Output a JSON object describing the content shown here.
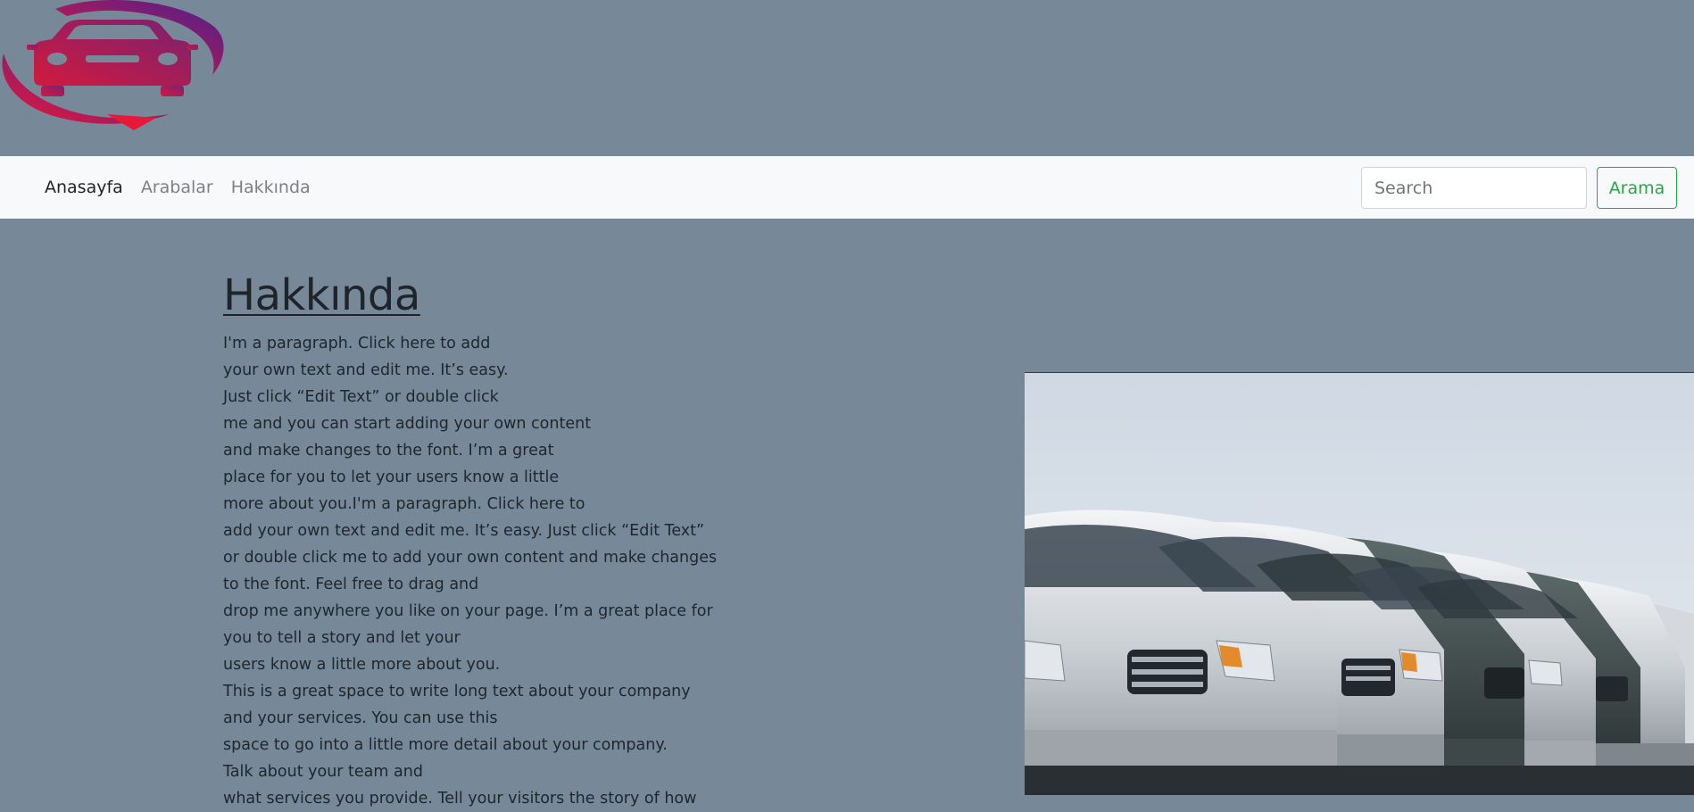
{
  "nav": {
    "links": [
      {
        "label": "Anasayfa",
        "active": true
      },
      {
        "label": "Arabalar",
        "active": false
      },
      {
        "label": "Hakkında",
        "active": false
      }
    ],
    "search_placeholder": "Search",
    "search_button_label": "Arama"
  },
  "about": {
    "title": "Hakkında",
    "lines": [
      "I'm a paragraph. Click here to add",
      "your own text and edit me. It’s easy.",
      "Just click “Edit Text” or double click",
      "me and you can start adding your own content",
      "and make changes to the font. I’m a great",
      "place for you to let your users know a little",
      "more about you.I'm a paragraph. Click here to",
      "add your own text and edit me. It’s easy. Just click “Edit Text”",
      "or double click me to add your own content and make changes",
      "to the font. Feel free to drag and",
      "drop me anywhere you like on your page. I’m a great place for",
      "you to tell a story and let your",
      "users know a little more about you.",
      "This is a great space to write long text about your company",
      "and your services. You can use this",
      "space to go into a little more detail about your company.",
      "Talk about your team and",
      "what services you provide. Tell your visitors the story of how"
    ]
  },
  "colors": {
    "page_background": "#778899",
    "navbar_background": "#f8f9fa",
    "accent_green": "#28a745",
    "logo_gradient_start": "#e8183a",
    "logo_gradient_end": "#4a1f8e"
  },
  "icons": {
    "logo": "car-care-logo",
    "hero": "car-lineup-photo"
  }
}
